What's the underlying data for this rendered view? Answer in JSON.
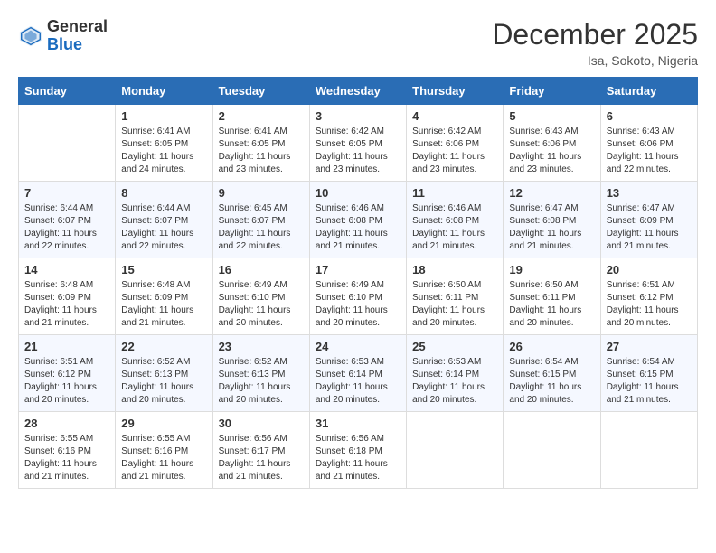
{
  "logo": {
    "general": "General",
    "blue": "Blue"
  },
  "title": "December 2025",
  "location": "Isa, Sokoto, Nigeria",
  "days_of_week": [
    "Sunday",
    "Monday",
    "Tuesday",
    "Wednesday",
    "Thursday",
    "Friday",
    "Saturday"
  ],
  "weeks": [
    [
      {
        "day": "",
        "sunrise": "",
        "sunset": "",
        "daylight": ""
      },
      {
        "day": "1",
        "sunrise": "Sunrise: 6:41 AM",
        "sunset": "Sunset: 6:05 PM",
        "daylight": "Daylight: 11 hours and 24 minutes."
      },
      {
        "day": "2",
        "sunrise": "Sunrise: 6:41 AM",
        "sunset": "Sunset: 6:05 PM",
        "daylight": "Daylight: 11 hours and 23 minutes."
      },
      {
        "day": "3",
        "sunrise": "Sunrise: 6:42 AM",
        "sunset": "Sunset: 6:05 PM",
        "daylight": "Daylight: 11 hours and 23 minutes."
      },
      {
        "day": "4",
        "sunrise": "Sunrise: 6:42 AM",
        "sunset": "Sunset: 6:06 PM",
        "daylight": "Daylight: 11 hours and 23 minutes."
      },
      {
        "day": "5",
        "sunrise": "Sunrise: 6:43 AM",
        "sunset": "Sunset: 6:06 PM",
        "daylight": "Daylight: 11 hours and 23 minutes."
      },
      {
        "day": "6",
        "sunrise": "Sunrise: 6:43 AM",
        "sunset": "Sunset: 6:06 PM",
        "daylight": "Daylight: 11 hours and 22 minutes."
      }
    ],
    [
      {
        "day": "7",
        "sunrise": "Sunrise: 6:44 AM",
        "sunset": "Sunset: 6:07 PM",
        "daylight": "Daylight: 11 hours and 22 minutes."
      },
      {
        "day": "8",
        "sunrise": "Sunrise: 6:44 AM",
        "sunset": "Sunset: 6:07 PM",
        "daylight": "Daylight: 11 hours and 22 minutes."
      },
      {
        "day": "9",
        "sunrise": "Sunrise: 6:45 AM",
        "sunset": "Sunset: 6:07 PM",
        "daylight": "Daylight: 11 hours and 22 minutes."
      },
      {
        "day": "10",
        "sunrise": "Sunrise: 6:46 AM",
        "sunset": "Sunset: 6:08 PM",
        "daylight": "Daylight: 11 hours and 21 minutes."
      },
      {
        "day": "11",
        "sunrise": "Sunrise: 6:46 AM",
        "sunset": "Sunset: 6:08 PM",
        "daylight": "Daylight: 11 hours and 21 minutes."
      },
      {
        "day": "12",
        "sunrise": "Sunrise: 6:47 AM",
        "sunset": "Sunset: 6:08 PM",
        "daylight": "Daylight: 11 hours and 21 minutes."
      },
      {
        "day": "13",
        "sunrise": "Sunrise: 6:47 AM",
        "sunset": "Sunset: 6:09 PM",
        "daylight": "Daylight: 11 hours and 21 minutes."
      }
    ],
    [
      {
        "day": "14",
        "sunrise": "Sunrise: 6:48 AM",
        "sunset": "Sunset: 6:09 PM",
        "daylight": "Daylight: 11 hours and 21 minutes."
      },
      {
        "day": "15",
        "sunrise": "Sunrise: 6:48 AM",
        "sunset": "Sunset: 6:09 PM",
        "daylight": "Daylight: 11 hours and 21 minutes."
      },
      {
        "day": "16",
        "sunrise": "Sunrise: 6:49 AM",
        "sunset": "Sunset: 6:10 PM",
        "daylight": "Daylight: 11 hours and 20 minutes."
      },
      {
        "day": "17",
        "sunrise": "Sunrise: 6:49 AM",
        "sunset": "Sunset: 6:10 PM",
        "daylight": "Daylight: 11 hours and 20 minutes."
      },
      {
        "day": "18",
        "sunrise": "Sunrise: 6:50 AM",
        "sunset": "Sunset: 6:11 PM",
        "daylight": "Daylight: 11 hours and 20 minutes."
      },
      {
        "day": "19",
        "sunrise": "Sunrise: 6:50 AM",
        "sunset": "Sunset: 6:11 PM",
        "daylight": "Daylight: 11 hours and 20 minutes."
      },
      {
        "day": "20",
        "sunrise": "Sunrise: 6:51 AM",
        "sunset": "Sunset: 6:12 PM",
        "daylight": "Daylight: 11 hours and 20 minutes."
      }
    ],
    [
      {
        "day": "21",
        "sunrise": "Sunrise: 6:51 AM",
        "sunset": "Sunset: 6:12 PM",
        "daylight": "Daylight: 11 hours and 20 minutes."
      },
      {
        "day": "22",
        "sunrise": "Sunrise: 6:52 AM",
        "sunset": "Sunset: 6:13 PM",
        "daylight": "Daylight: 11 hours and 20 minutes."
      },
      {
        "day": "23",
        "sunrise": "Sunrise: 6:52 AM",
        "sunset": "Sunset: 6:13 PM",
        "daylight": "Daylight: 11 hours and 20 minutes."
      },
      {
        "day": "24",
        "sunrise": "Sunrise: 6:53 AM",
        "sunset": "Sunset: 6:14 PM",
        "daylight": "Daylight: 11 hours and 20 minutes."
      },
      {
        "day": "25",
        "sunrise": "Sunrise: 6:53 AM",
        "sunset": "Sunset: 6:14 PM",
        "daylight": "Daylight: 11 hours and 20 minutes."
      },
      {
        "day": "26",
        "sunrise": "Sunrise: 6:54 AM",
        "sunset": "Sunset: 6:15 PM",
        "daylight": "Daylight: 11 hours and 20 minutes."
      },
      {
        "day": "27",
        "sunrise": "Sunrise: 6:54 AM",
        "sunset": "Sunset: 6:15 PM",
        "daylight": "Daylight: 11 hours and 21 minutes."
      }
    ],
    [
      {
        "day": "28",
        "sunrise": "Sunrise: 6:55 AM",
        "sunset": "Sunset: 6:16 PM",
        "daylight": "Daylight: 11 hours and 21 minutes."
      },
      {
        "day": "29",
        "sunrise": "Sunrise: 6:55 AM",
        "sunset": "Sunset: 6:16 PM",
        "daylight": "Daylight: 11 hours and 21 minutes."
      },
      {
        "day": "30",
        "sunrise": "Sunrise: 6:56 AM",
        "sunset": "Sunset: 6:17 PM",
        "daylight": "Daylight: 11 hours and 21 minutes."
      },
      {
        "day": "31",
        "sunrise": "Sunrise: 6:56 AM",
        "sunset": "Sunset: 6:18 PM",
        "daylight": "Daylight: 11 hours and 21 minutes."
      },
      {
        "day": "",
        "sunrise": "",
        "sunset": "",
        "daylight": ""
      },
      {
        "day": "",
        "sunrise": "",
        "sunset": "",
        "daylight": ""
      },
      {
        "day": "",
        "sunrise": "",
        "sunset": "",
        "daylight": ""
      }
    ]
  ]
}
